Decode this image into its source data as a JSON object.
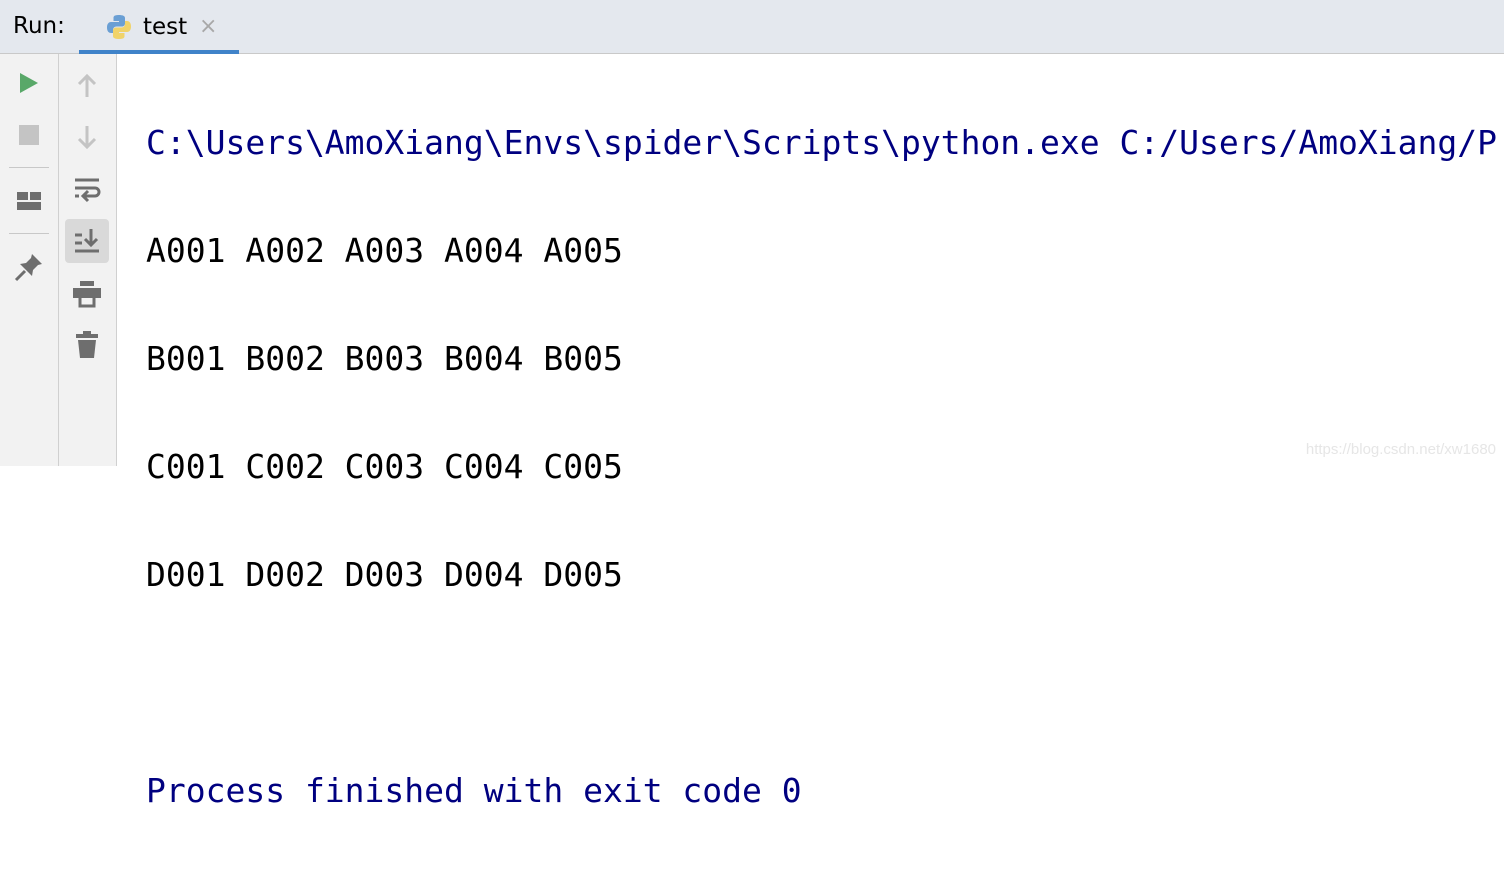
{
  "header": {
    "run_label": "Run:",
    "tab": {
      "label": "test",
      "close": "×"
    }
  },
  "toolbar_left": [
    {
      "name": "run"
    },
    {
      "name": "stop"
    },
    {
      "name": "layout"
    },
    {
      "name": "pin"
    }
  ],
  "toolbar_right": [
    {
      "name": "up"
    },
    {
      "name": "down"
    },
    {
      "name": "soft-wrap"
    },
    {
      "name": "scroll-to-end",
      "active": true
    },
    {
      "name": "print"
    },
    {
      "name": "clear"
    }
  ],
  "console": {
    "command": "C:\\Users\\AmoXiang\\Envs\\spider\\Scripts\\python.exe C:/Users/AmoXiang/P",
    "lines": [
      "A001 A002 A003 A004 A005",
      "B001 B002 B003 B004 B005",
      "C001 C002 C003 C004 C005",
      "D001 D002 D003 D004 D005"
    ],
    "blank": "",
    "exit": "Process finished with exit code 0"
  },
  "watermark": "https://blog.csdn.net/xw1680",
  "colors": {
    "accent": "#4083c9",
    "run": "#59a869",
    "console_blue": "#000080"
  }
}
